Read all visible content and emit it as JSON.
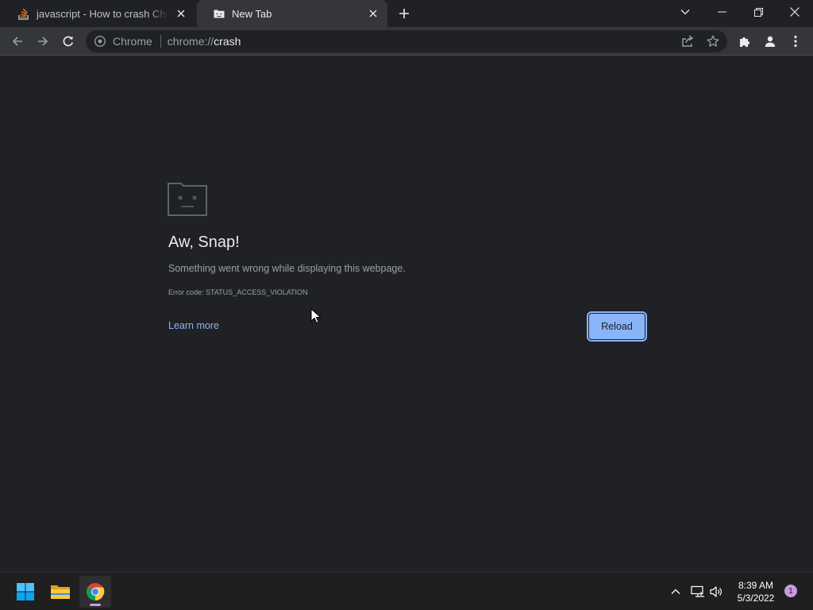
{
  "tabs": [
    {
      "title": "javascript - How to crash Chrome",
      "icon": "stackoverflow-icon",
      "active": false
    },
    {
      "title": "New Tab",
      "icon": "sad-tab-favicon-icon",
      "active": true
    }
  ],
  "omnibox": {
    "site_name": "Chrome",
    "url_scheme": "chrome://",
    "url_host": "crash"
  },
  "page": {
    "heading": "Aw, Snap!",
    "message": "Something went wrong while displaying this webpage.",
    "error_code": "Error code: STATUS_ACCESS_VIOLATION",
    "learn_more": "Learn more",
    "reload_label": "Reload"
  },
  "taskbar": {
    "apps": [
      "windows-start-icon",
      "file-explorer-icon",
      "chrome-icon"
    ],
    "time": "8:39 AM",
    "date": "5/3/2022",
    "notification_count": "1"
  },
  "colors": {
    "accent": "#8ab4f8",
    "page_background": "#202124",
    "toolbar_background": "#35363a",
    "taskbar_indicator": "#c79be0"
  }
}
